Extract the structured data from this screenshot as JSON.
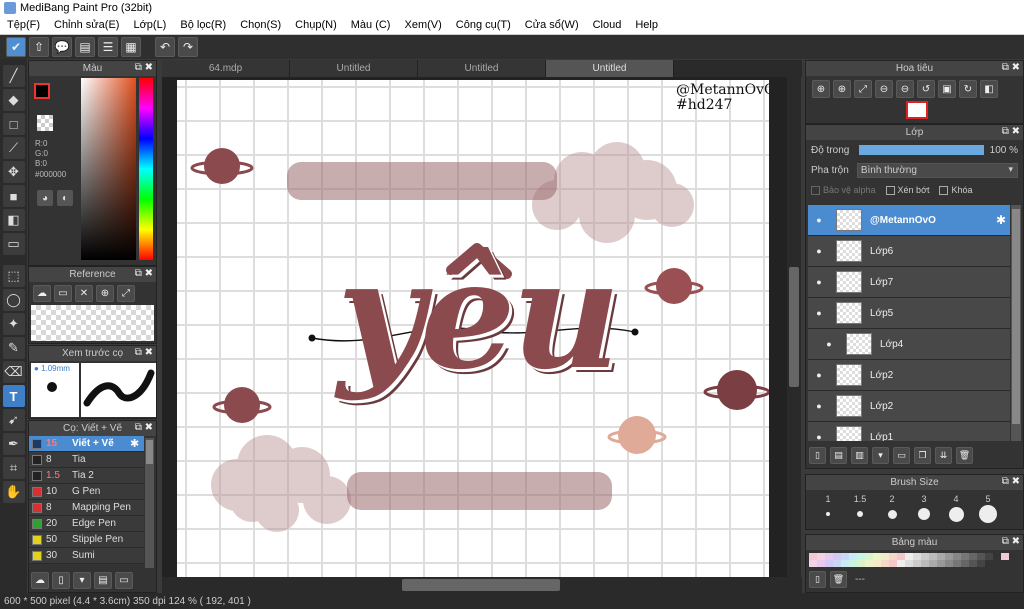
{
  "window": {
    "title": "MediBang Paint Pro (32bit)"
  },
  "menu": [
    "Tệp(F)",
    "Chỉnh sửa(E)",
    "Lớp(L)",
    "Bộ lọc(R)",
    "Chọn(S)",
    "Chụp(N)",
    "Màu (C)",
    "Xem(V)",
    "Công cụ(T)",
    "Cửa sổ(W)",
    "Cloud",
    "Help"
  ],
  "panels": {
    "color": {
      "title": "Màu",
      "r": "R:0",
      "g": "G:0",
      "b": "B:0",
      "hex": "#000000"
    },
    "reference": {
      "title": "Reference"
    },
    "brush_preview": {
      "title": "Xem trước cọ",
      "size": "1.09mm"
    },
    "brush": {
      "title": "Cọ: Viết + Vẽ"
    },
    "navigator": {
      "title": "Hoa tiêu"
    },
    "layer": {
      "title": "Lớp",
      "opacity_label": "Độ trong",
      "opacity_value": "100 %",
      "blend_label": "Pha trộn",
      "blend_value": "Bình thường",
      "protect_alpha": "Bảo vệ alpha",
      "clip": "Xén bớt",
      "lock": "Khóa"
    },
    "brush_size": {
      "title": "Brush Size",
      "sizes": [
        "1",
        "1.5",
        "2",
        "3",
        "4",
        "5"
      ]
    },
    "palette": {
      "title": "Bảng màu",
      "footer_text": "---"
    }
  },
  "brushes": [
    {
      "size": "15",
      "name": "Viết + Vẽ",
      "color": "#1a3a6a",
      "selected": true
    },
    {
      "size": "8",
      "name": "Tia",
      "color": "#222222"
    },
    {
      "size": "1.5",
      "name": "Tia 2",
      "color": "#222222"
    },
    {
      "size": "10",
      "name": "G Pen",
      "color": "#d83030"
    },
    {
      "size": "8",
      "name": "Mapping Pen",
      "color": "#d83030"
    },
    {
      "size": "20",
      "name": "Edge Pen",
      "color": "#30a030"
    },
    {
      "size": "50",
      "name": "Stipple Pen",
      "color": "#e0d020"
    },
    {
      "size": "30",
      "name": "Sumi",
      "color": "#e0d020"
    }
  ],
  "tabs": [
    "64.mdp",
    "Untitled",
    "Untitled",
    "Untitled"
  ],
  "canvas": {
    "watermark_line1": "@MetannOvO",
    "watermark_line2": "#hd247",
    "lettering": "yêu",
    "art_color": "#8b4a4e"
  },
  "layers": [
    {
      "name": "@MetannOvO",
      "selected": true
    },
    {
      "name": "Lớp6"
    },
    {
      "name": "Lớp7"
    },
    {
      "name": "Lớp5"
    },
    {
      "name": "Lớp4",
      "child": true
    },
    {
      "name": "Lớp2"
    },
    {
      "name": "Lớp2"
    },
    {
      "name": "Lớp1"
    }
  ],
  "status": {
    "text": "600 * 500 pixel   (4.4 * 3.6cm)   350 dpi   124 %   ( 192, 401 )"
  }
}
